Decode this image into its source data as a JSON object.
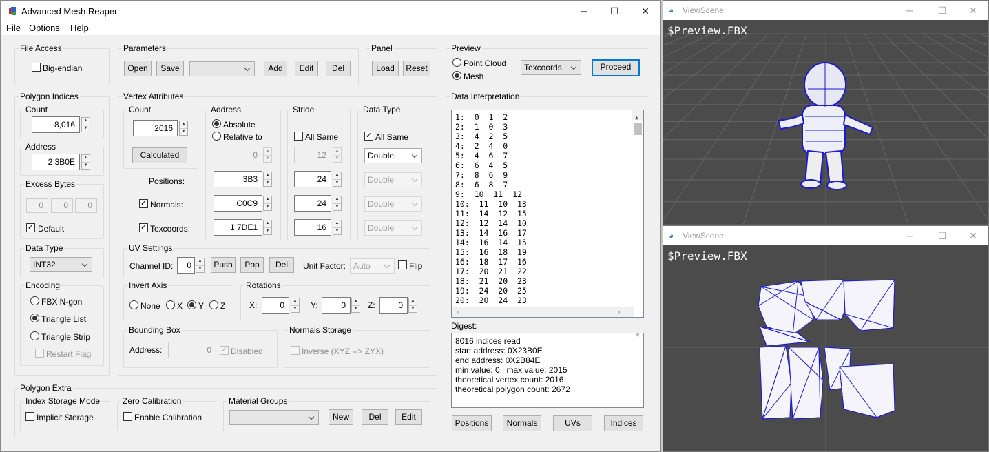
{
  "window": {
    "title": "Advanced Mesh Reaper",
    "minimize": "─",
    "maximize": "☐",
    "close": "✕"
  },
  "menu": [
    "File",
    "Options",
    "Help"
  ],
  "file_access": {
    "title": "File Access",
    "big_endian": "Big-endian"
  },
  "parameters": {
    "title": "Parameters",
    "open": "Open",
    "save": "Save",
    "add": "Add",
    "edit": "Edit",
    "del": "Del",
    "preset": ""
  },
  "panel": {
    "title": "Panel",
    "load": "Load",
    "reset": "Reset"
  },
  "preview": {
    "title": "Preview",
    "point_cloud": "Point Cloud",
    "mesh": "Mesh",
    "mode": "Texcoords",
    "proceed": "Proceed"
  },
  "polygon_indices": {
    "title": "Polygon Indices",
    "count_label": "Count",
    "count": "8,016",
    "address_label": "Address",
    "address": "2 3B0E",
    "excess_title": "Excess Bytes",
    "excess": [
      "0",
      "0",
      "0"
    ],
    "default": "Default",
    "dtype_title": "Data Type",
    "dtype": "INT32",
    "encoding_title": "Encoding",
    "fbx": "FBX N-gon",
    "tri_list": "Triangle List",
    "tri_strip": "Triangle Strip",
    "restart": "Restart Flag"
  },
  "vertex_attributes": {
    "title": "Vertex Attributes",
    "count_label": "Count",
    "count": "2016",
    "calculated": "Calculated",
    "positions": "Positions:",
    "normals": "Normals:",
    "texcoords": "Texcoords:",
    "address_title": "Address",
    "absolute": "Absolute",
    "relative": "Relative to",
    "rel_value": "0",
    "addr_pos": "3B3",
    "addr_norm": "C0C9",
    "addr_tex": "1 7DE1",
    "stride_title": "Stride",
    "all_same": "All Same",
    "stride_all": "12",
    "stride_pos": "24",
    "stride_norm": "24",
    "stride_tex": "16",
    "dtype_title": "Data Type",
    "dtype_all_same": "All Same",
    "dtype": "Double",
    "dtype_pos": "Double",
    "dtype_norm": "Double",
    "dtype_tex": "Double"
  },
  "uv": {
    "title": "UV Settings",
    "channel_label": "Channel ID:",
    "channel": "0",
    "push": "Push",
    "pop": "Pop",
    "del": "Del",
    "unit_label": "Unit Factor:",
    "unit": "Auto",
    "flip": "Flip"
  },
  "invert": {
    "title": "Invert Axis",
    "none": "None",
    "x": "X",
    "y": "Y",
    "z": "Z"
  },
  "rotations": {
    "title": "Rotations",
    "x": "X:",
    "y": "Y:",
    "z": "Z:",
    "xv": "0",
    "yv": "0",
    "zv": "0"
  },
  "bbox": {
    "title": "Bounding Box",
    "address": "Address:",
    "value": "0",
    "disabled": "Disabled"
  },
  "normals_storage": {
    "title": "Normals Storage",
    "inverse": "Inverse (XYZ --> ZYX)"
  },
  "polygon_extra": {
    "title": "Polygon Extra",
    "index_mode": "Index Storage Mode",
    "implicit": "Implicit Storage",
    "zero_cal": "Zero Calibration",
    "enable_cal": "Enable Calibration",
    "mat_groups": "Material Groups",
    "new": "New",
    "del": "Del",
    "edit": "Edit"
  },
  "data_interp": {
    "title": "Data Interpretation",
    "rows": [
      "1:  0  1  2",
      "2:  1  0  3",
      "3:  4  2  5",
      "4:  2  4  0",
      "5:  4  6  7",
      "6:  6  4  5",
      "7:  8  6  9",
      "8:  6  8  7",
      "9:  10  11  12",
      "10:  11  10  13",
      "11:  14  12  15",
      "12:  12  14  10",
      "13:  14  16  17",
      "14:  16  14  15",
      "15:  16  18  19",
      "16:  18  17  16",
      "17:  20  21  22",
      "18:  21  20  23",
      "19:  24  20  25",
      "20:  20  24  23"
    ]
  },
  "digest": {
    "title": "Digest:",
    "lines": [
      "8016 indices read",
      "start address: 0X23B0E",
      "end address: 0X2B84E",
      "min value: 0 | max value: 2015",
      "theoretical vertex count: 2016",
      "theoretical polygon count: 2672"
    ]
  },
  "bottom_tabs": [
    "Positions",
    "Normals",
    "UVs",
    "Indices"
  ],
  "viewscene": {
    "title": "ViewScene",
    "caption": "$Preview.FBX"
  },
  "colors": {
    "accent": "#0078d7",
    "wire": "#1a1ad0",
    "view_bg": "#4b4b4b"
  }
}
